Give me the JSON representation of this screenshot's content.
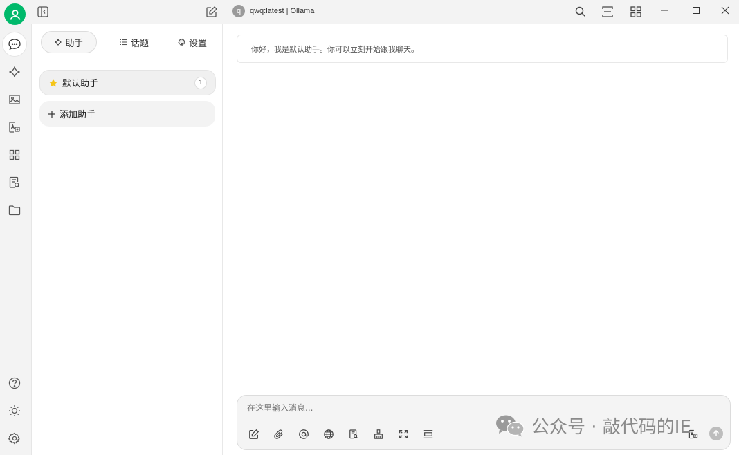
{
  "titlebar": {
    "model_initial": "q",
    "model_name": "qwq:latest | Ollama"
  },
  "sidebar_tabs": {
    "assistants": "助手",
    "topics": "话题",
    "settings": "设置"
  },
  "assistants": [
    {
      "name": "默认助手",
      "count": "1"
    }
  ],
  "add_assistant_label": "添加助手",
  "chat": {
    "greeting": "你好，我是默认助手。你可以立刻开始跟我聊天。"
  },
  "composer": {
    "placeholder": "在这里输入消息..."
  },
  "watermark": {
    "text": "公众号 · 敲代码的IE"
  },
  "colors": {
    "accent": "#00b96b",
    "star": "#f5c518"
  }
}
